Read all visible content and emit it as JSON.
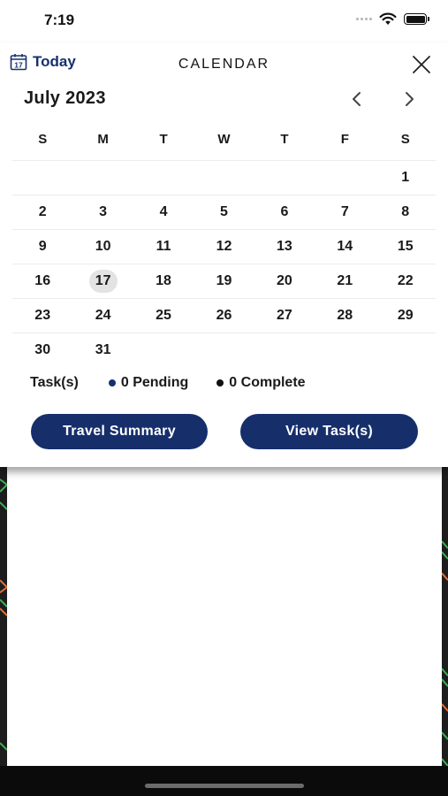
{
  "status_bar": {
    "time": "7:19",
    "icons": [
      "cellular-signal-icon",
      "wifi-icon",
      "battery-icon"
    ]
  },
  "header": {
    "today_label": "Today",
    "today_icon_day": "17",
    "title": "CALENDAR",
    "close_icon": "close-icon"
  },
  "calendar": {
    "month_label": "July 2023",
    "prev_icon": "chevron-left-icon",
    "next_icon": "chevron-right-icon",
    "weekdays": [
      "S",
      "M",
      "T",
      "W",
      "T",
      "F",
      "S"
    ],
    "weeks": [
      [
        "",
        "",
        "",
        "",
        "",
        "",
        "1"
      ],
      [
        "2",
        "3",
        "4",
        "5",
        "6",
        "7",
        "8"
      ],
      [
        "9",
        "10",
        "11",
        "12",
        "13",
        "14",
        "15"
      ],
      [
        "16",
        "17",
        "18",
        "19",
        "20",
        "21",
        "22"
      ],
      [
        "23",
        "24",
        "25",
        "26",
        "27",
        "28",
        "29"
      ],
      [
        "30",
        "31",
        "",
        "",
        "",
        "",
        ""
      ]
    ],
    "selected_day": "17"
  },
  "tasks": {
    "label": "Task(s)",
    "pending_label": "0 Pending",
    "complete_label": "0 Complete",
    "pending_color": "#16306e",
    "complete_color": "#111111"
  },
  "actions": {
    "travel_summary_label": "Travel Summary",
    "view_tasks_label": "View Task(s)",
    "button_color": "#162f6b"
  }
}
